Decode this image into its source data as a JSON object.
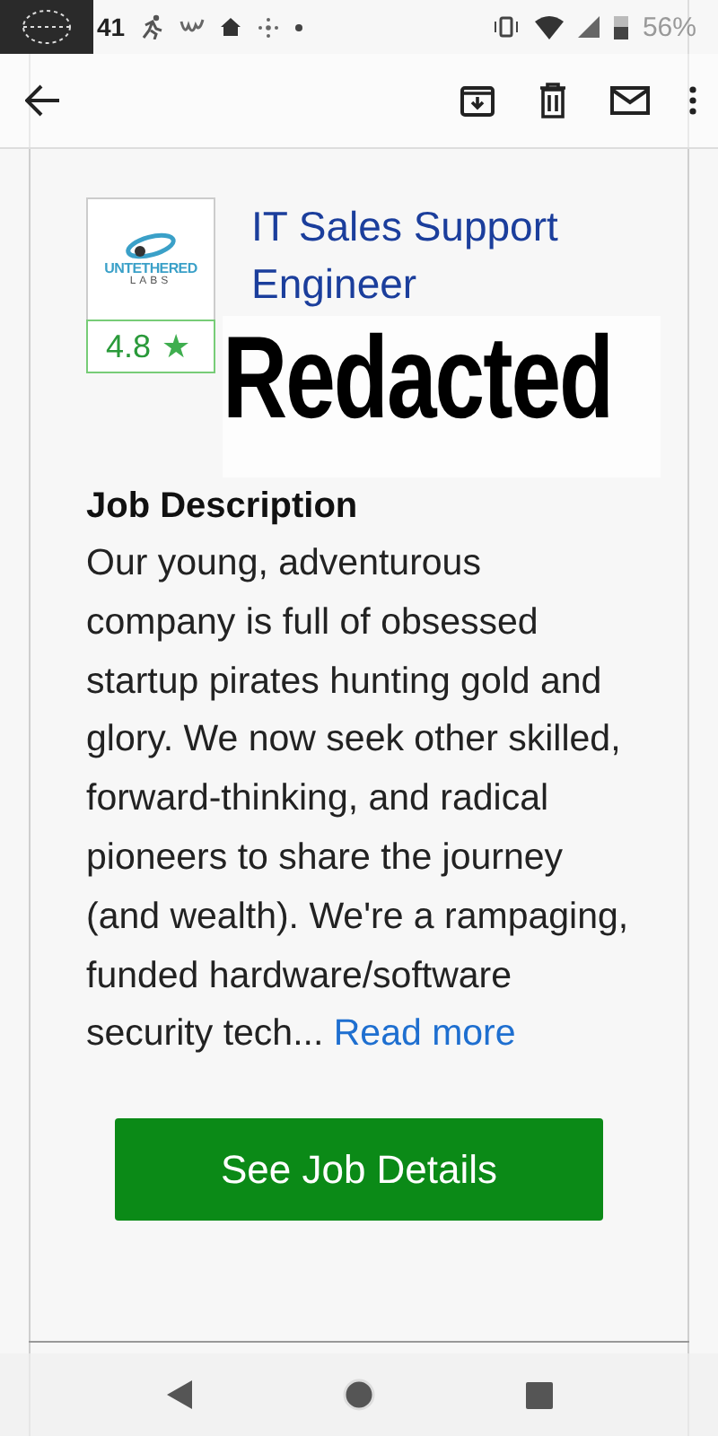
{
  "status_bar": {
    "time": "41",
    "battery": "56%"
  },
  "job": {
    "title": "IT Sales Support Engineer",
    "logo_text": "UNTETHERED",
    "logo_subtext": "LABS",
    "rating": "4.8",
    "rating_star": "★",
    "redaction": "Redacted",
    "section_heading": "Job Description",
    "description": "Our young, adventurous company is full of obsessed startup pirates hunting gold and glory. We now seek other skilled, forward-thinking, and radical pioneers to share the journey (and wealth). We're a rampaging, funded hardware/software security tech... ",
    "read_more": "Read more",
    "button": "See Job Details"
  }
}
